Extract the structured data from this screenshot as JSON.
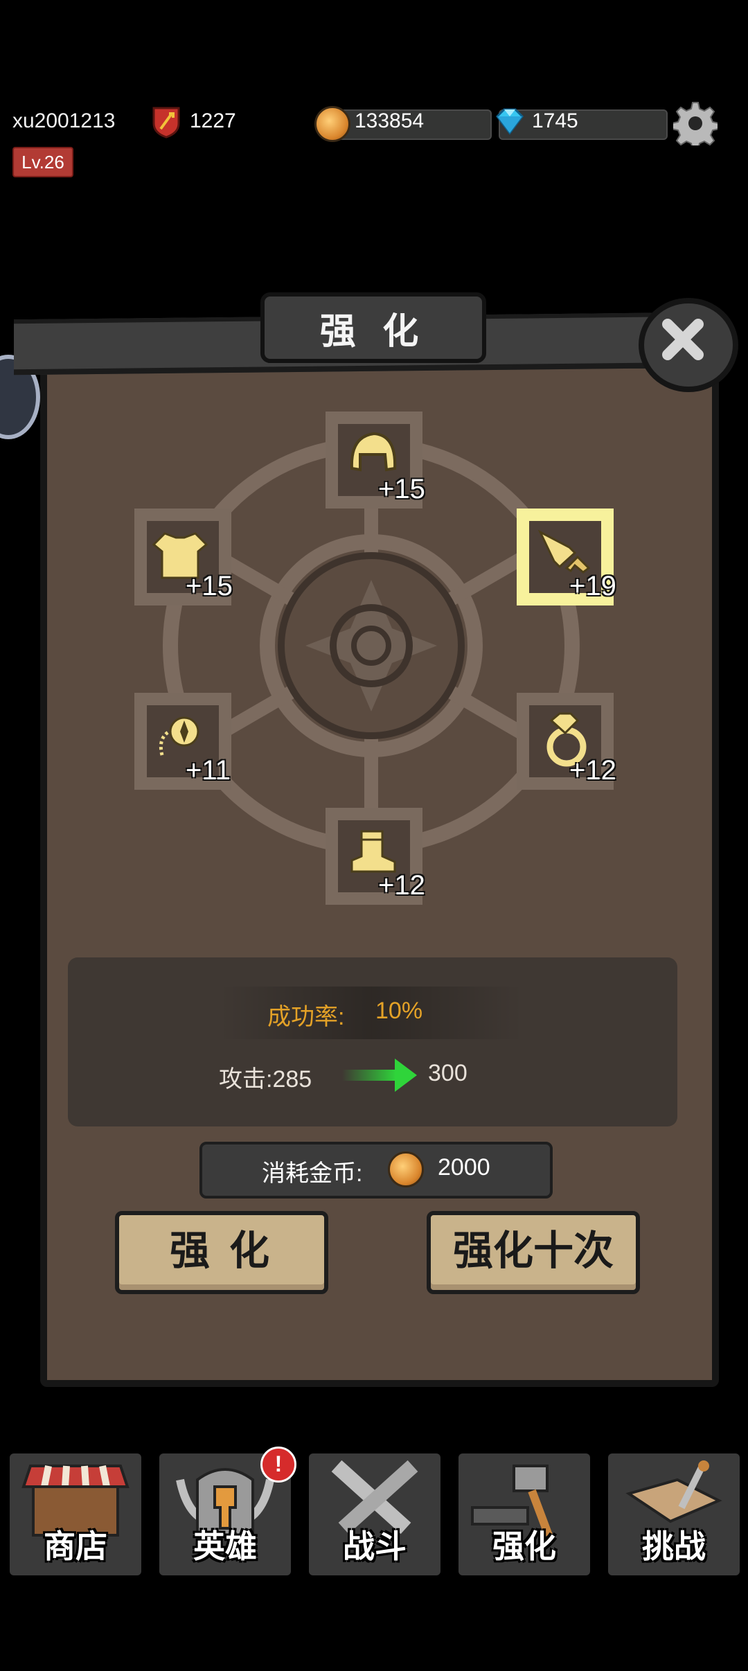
{
  "player": {
    "username": "xu2001213",
    "level": "Lv.26",
    "power": "1227",
    "gold": "133854",
    "gems": "1745"
  },
  "panel": {
    "title": "强 化"
  },
  "equipment": [
    {
      "slot": "helmet",
      "bonus": "+15",
      "selected": false
    },
    {
      "slot": "armor",
      "bonus": "+15",
      "selected": false
    },
    {
      "slot": "weapon",
      "bonus": "+19",
      "selected": true
    },
    {
      "slot": "amulet",
      "bonus": "+11",
      "selected": false
    },
    {
      "slot": "ring",
      "bonus": "+12",
      "selected": false
    },
    {
      "slot": "boots",
      "bonus": "+12",
      "selected": false
    }
  ],
  "enhance": {
    "rate_label": "成功率:",
    "rate_value": "10%",
    "attack_from": "攻击:285",
    "attack_to": "300",
    "cost_label": "消耗金币:",
    "cost_value": "2000",
    "button_once": "强 化",
    "button_ten": "强化十次"
  },
  "nav": [
    {
      "label": "商店",
      "icon": "shop-stall-icon"
    },
    {
      "label": "英雄",
      "icon": "hero-helmet-icon",
      "badge": "!"
    },
    {
      "label": "战斗",
      "icon": "crossed-swords-icon"
    },
    {
      "label": "强化",
      "icon": "hammer-icon"
    },
    {
      "label": "挑战",
      "icon": "challenge-map-icon"
    }
  ],
  "colors": {
    "panel_bg": "#5b4b40",
    "accent_gold": "#e4a227",
    "item_gold": "#f3df8c",
    "selected_bg": "#f7f19c",
    "arrow_green": "#2fd43a"
  }
}
